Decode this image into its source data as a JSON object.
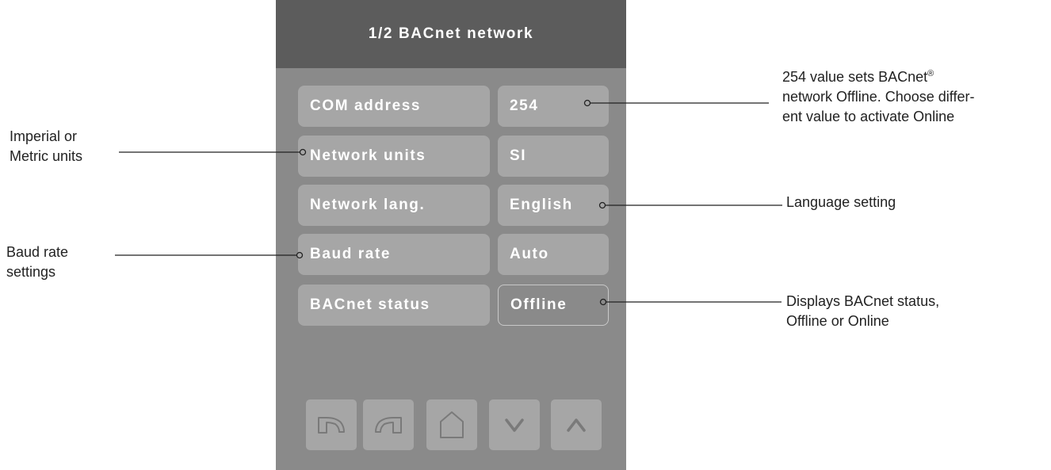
{
  "screen": {
    "title": "1/2 BACnet network"
  },
  "rows": [
    {
      "label": "COM address",
      "value": "254"
    },
    {
      "label": "Network units",
      "value": "SI"
    },
    {
      "label": "Network lang.",
      "value": "English"
    },
    {
      "label": "Baud rate",
      "value": "Auto"
    },
    {
      "label": "BACnet status",
      "value": "Offline"
    }
  ],
  "nav_buttons": [
    {
      "name": "back-icon"
    },
    {
      "name": "forward-icon"
    },
    {
      "name": "home-icon"
    },
    {
      "name": "chevron-down-icon"
    },
    {
      "name": "chevron-up-icon"
    }
  ],
  "annotations": {
    "com_address": {
      "line1": "254 value sets BACnet",
      "sup": "®",
      "line2": "network Offline. Choose differ-",
      "line3": "ent value to activate Online"
    },
    "units": {
      "line1": "Imperial or",
      "line2": "Metric units"
    },
    "language": {
      "line1": "Language setting"
    },
    "baud": {
      "line1": "Baud rate",
      "line2": "settings"
    },
    "status": {
      "line1": "Displays BACnet status,",
      "line2": "Offline or Online"
    }
  },
  "colors": {
    "panel": "#8a8a8a",
    "header": "#5c5c5c",
    "button": "#a6a6a6",
    "text": "#ffffff"
  }
}
